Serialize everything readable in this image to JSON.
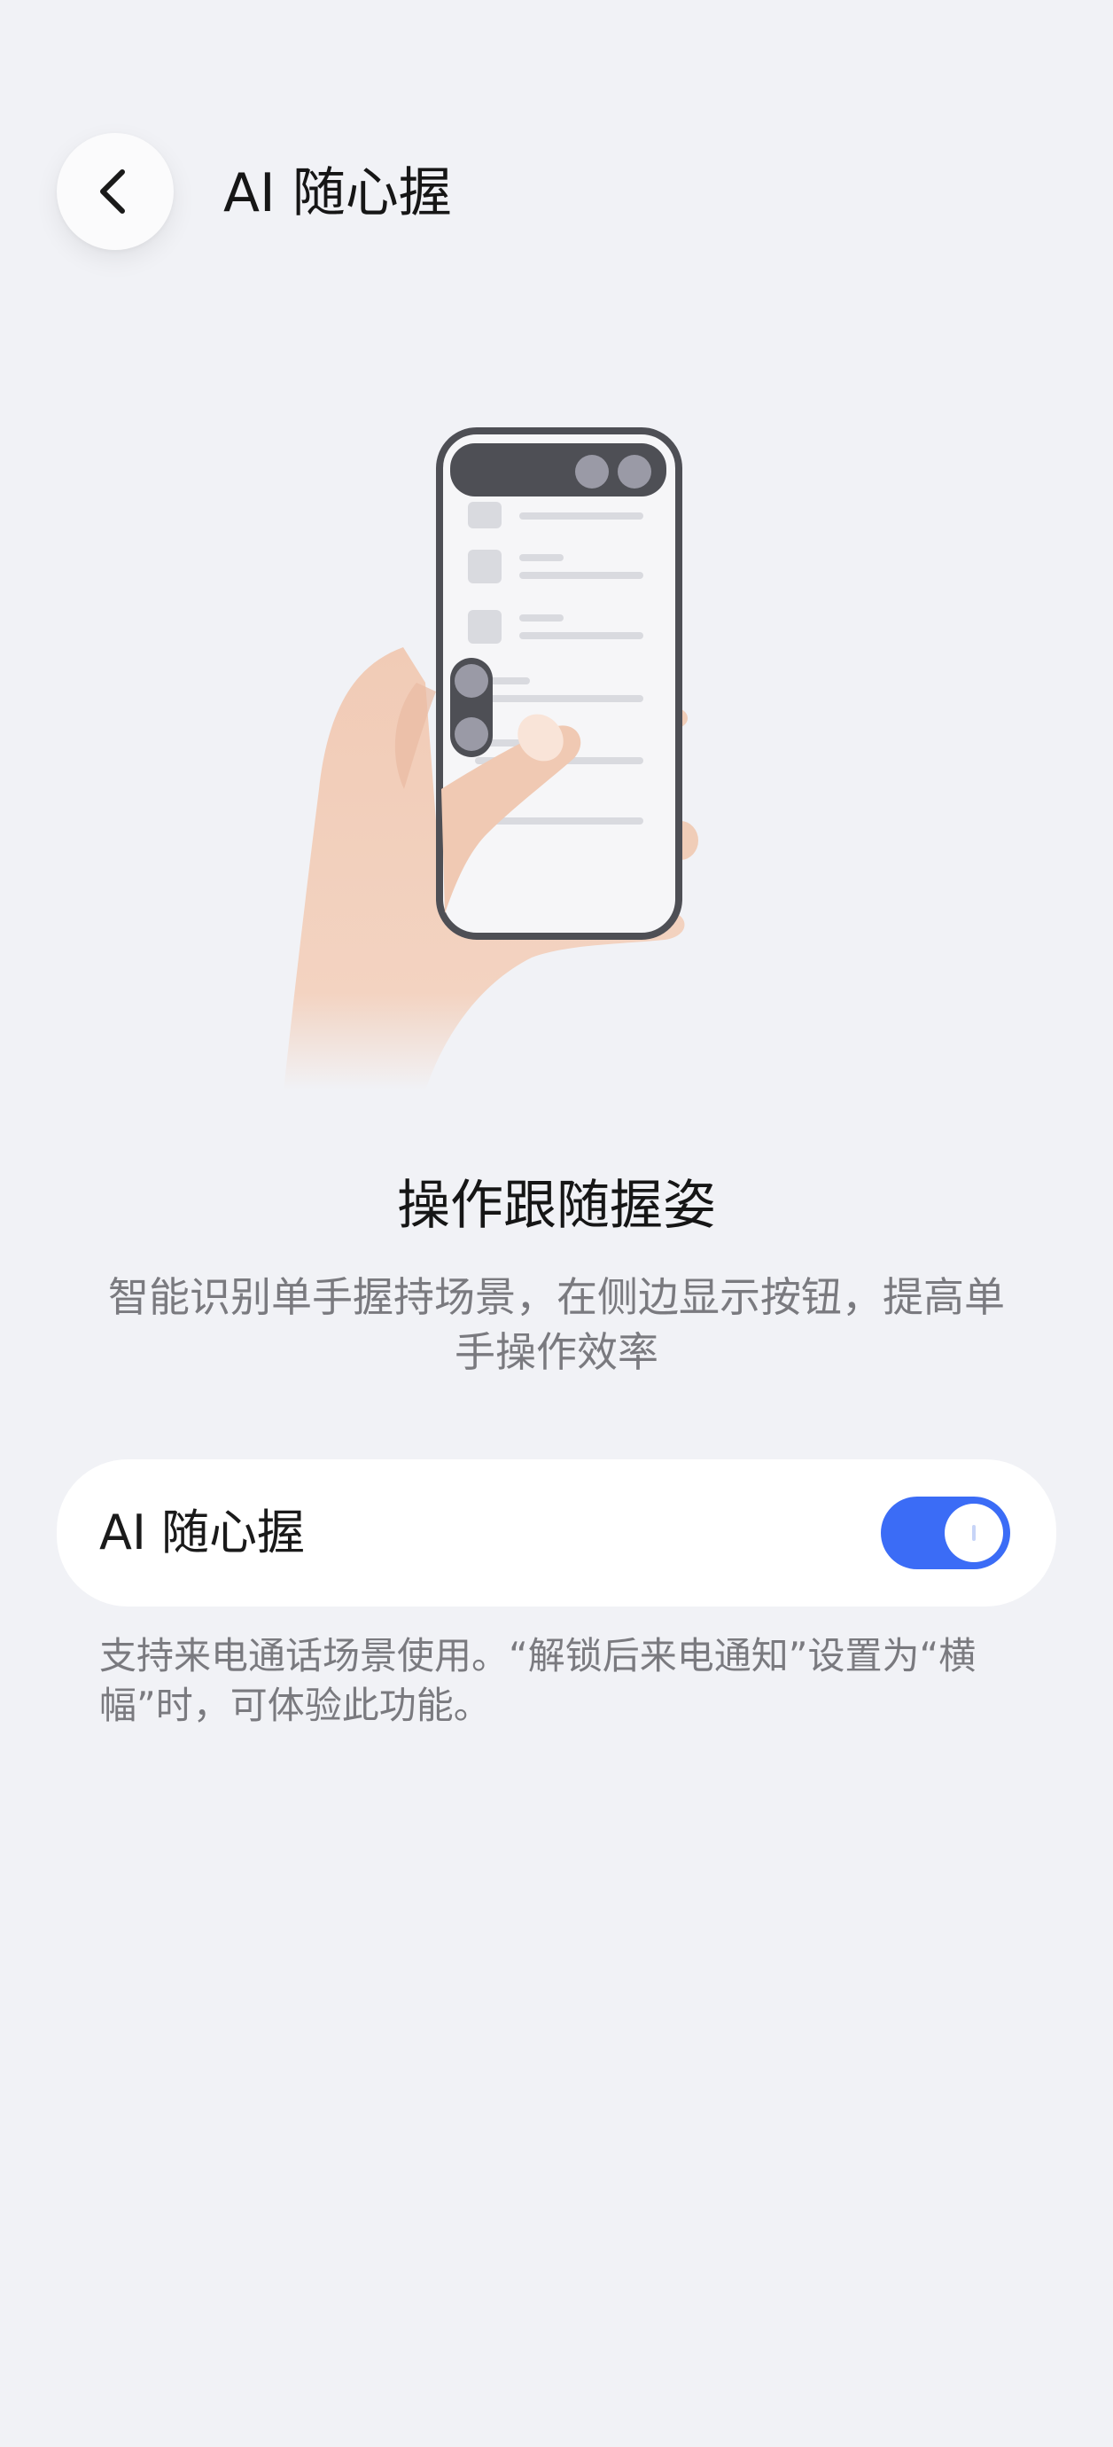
{
  "header": {
    "back_icon": "chevron-left-icon",
    "title": "AI 随心握"
  },
  "illustration": {
    "description_icon": "hand-holding-phone-illustration",
    "colors": {
      "skin": "#f1cdb8",
      "phone_frame": "#4e4f55",
      "side_button": "#9a9aa6",
      "list_item": "#d9dadf"
    }
  },
  "feature": {
    "title": "操作跟随握姿",
    "description": "智能识别单手握持场景，在侧边显示按钮，提高单手操作效率"
  },
  "setting": {
    "label": "AI 随心握",
    "enabled": true,
    "accent": "#3b6cf6"
  },
  "note": "支持来电通话场景使用。“解锁后来电通知”设置为“横幅”时，可体验此功能。"
}
